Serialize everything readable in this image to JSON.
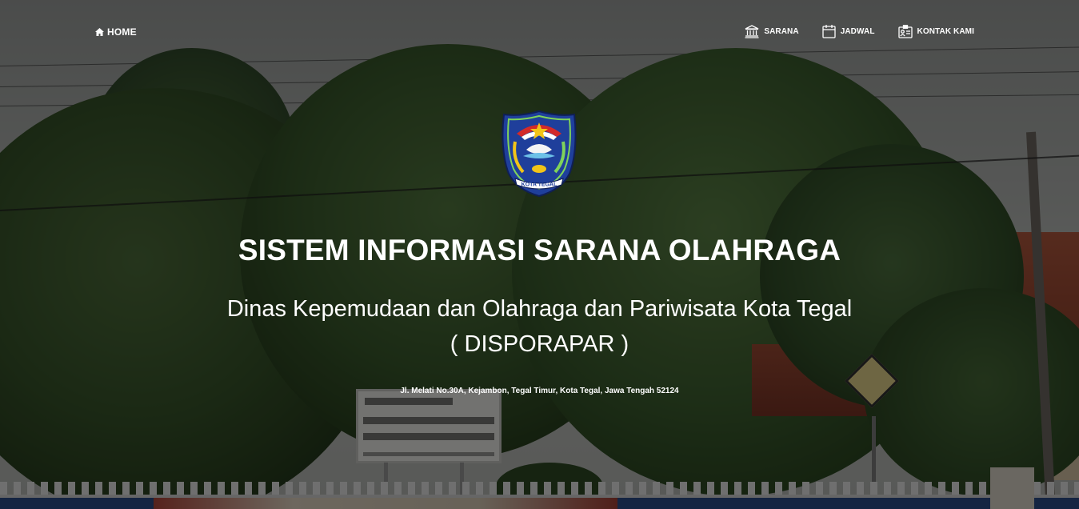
{
  "nav": {
    "home_label": "HOME",
    "home_icon": "home-icon",
    "links": [
      {
        "label": "SARANA",
        "icon": "building-icon"
      },
      {
        "label": "JADWAL",
        "icon": "calendar-icon"
      },
      {
        "label": "KONTAK KAMI",
        "icon": "contact-card-icon"
      }
    ]
  },
  "hero": {
    "logo_text": "KOTA TEGAL",
    "title": "SISTEM INFORMASI SARANA OLAHRAGA",
    "subtitle": "Dinas Kepemudaan dan Olahraga dan Pariwisata Kota Tegal",
    "subtitle_short": "( DISPORAPAR )",
    "address": "Jl. Melati No.30A, Kejambon, Tegal Timur, Kota Tegal, Jawa Tengah 52124"
  },
  "colors": {
    "overlay": "rgba(0,0,0,0.52)",
    "text": "#ffffff",
    "logo_blue": "#1f3f9b",
    "logo_red": "#d22a2a",
    "logo_gold": "#f2c418"
  }
}
